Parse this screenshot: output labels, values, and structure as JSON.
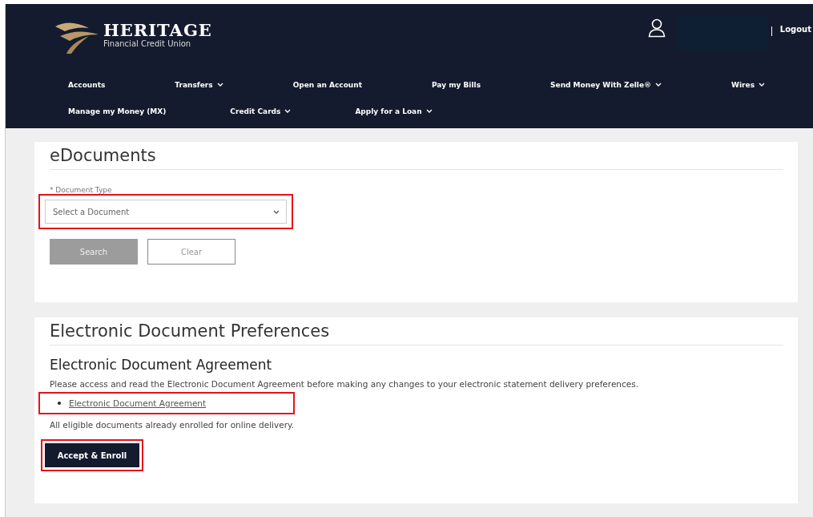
{
  "header": {
    "logo": {
      "name": "HERITAGE",
      "tagline": "Financial Credit Union"
    },
    "user": {
      "name_redacted": true
    },
    "logout": "Logout",
    "nav_rows": [
      [
        {
          "label": "Accounts",
          "has_menu": false
        },
        {
          "label": "Transfers",
          "has_menu": true
        },
        {
          "label": "Open an Account",
          "has_menu": false
        },
        {
          "label": "Pay my Bills",
          "has_menu": false
        },
        {
          "label": "Send Money With Zelle®",
          "has_menu": true
        },
        {
          "label": "Wires",
          "has_menu": true
        }
      ],
      [
        {
          "label": "Manage my Money (MX)",
          "has_menu": false
        },
        {
          "label": "Credit Cards",
          "has_menu": true
        },
        {
          "label": "Apply for a Loan",
          "has_menu": true
        }
      ]
    ]
  },
  "edocuments": {
    "title": "eDocuments",
    "field_label": "* Document Type",
    "select": {
      "placeholder": "Select a Document",
      "highlighted": true
    },
    "buttons": [
      {
        "label": "Search",
        "kind": "primary",
        "disabled": true
      },
      {
        "label": "Clear",
        "kind": "secondary",
        "disabled": false
      }
    ]
  },
  "preferences": {
    "title": "Electronic Document Preferences",
    "subtitle": "Electronic Document Agreement",
    "intro": "Please access and read the Electronic Document Agreement before making any changes to your electronic statement delivery preferences.",
    "links": [
      {
        "label": "Electronic Document Agreement",
        "highlighted": true
      }
    ],
    "status": "All eligible documents already enrolled for online delivery.",
    "action": {
      "label": "Accept & Enroll",
      "highlighted": true
    }
  }
}
